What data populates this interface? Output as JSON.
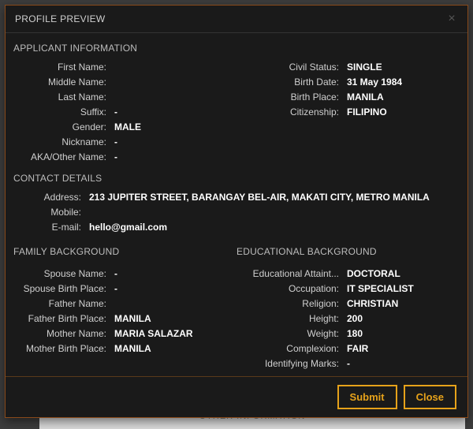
{
  "backdrop_title": "OTHER INFORMATION",
  "modal": {
    "title": "PROFILE PREVIEW",
    "close_x": "×"
  },
  "sections": {
    "applicant": "APPLICANT INFORMATION",
    "contact": "CONTACT DETAILS",
    "family": "FAMILY BACKGROUND",
    "education": "EDUCATIONAL BACKGROUND"
  },
  "applicant_left": [
    {
      "label": "First Name:",
      "value": ""
    },
    {
      "label": "Middle Name:",
      "value": ""
    },
    {
      "label": "Last Name:",
      "value": ""
    },
    {
      "label": "Suffix:",
      "value": "-"
    },
    {
      "label": "Gender:",
      "value": "MALE"
    },
    {
      "label": "Nickname:",
      "value": "-"
    },
    {
      "label": "AKA/Other Name:",
      "value": "-"
    }
  ],
  "applicant_right": [
    {
      "label": "Civil Status:",
      "value": "SINGLE"
    },
    {
      "label": "Birth Date:",
      "value": "31 May 1984"
    },
    {
      "label": "Birth Place:",
      "value": "MANILA"
    },
    {
      "label": "Citizenship:",
      "value": "FILIPINO"
    }
  ],
  "contact": [
    {
      "label": "Address:",
      "value": "213 JUPITER STREET, BARANGAY BEL-AIR, MAKATI CITY, METRO MANILA"
    },
    {
      "label": "Mobile:",
      "value": ""
    },
    {
      "label": "E-mail:",
      "value": "hello@gmail.com"
    }
  ],
  "family": [
    {
      "label": "Spouse Name:",
      "value": "-"
    },
    {
      "label": "Spouse Birth Place:",
      "value": "-"
    },
    {
      "label": "Father Name:",
      "value": ""
    },
    {
      "label": "Father Birth Place:",
      "value": "MANILA"
    },
    {
      "label": "Mother Name:",
      "value": "MARIA SALAZAR"
    },
    {
      "label": "Mother Birth Place:",
      "value": "MANILA"
    }
  ],
  "education": [
    {
      "label": "Educational Attaint...",
      "value": "DOCTORAL"
    },
    {
      "label": "Occupation:",
      "value": "IT SPECIALIST"
    },
    {
      "label": "Religion:",
      "value": "CHRISTIAN"
    },
    {
      "label": "Height:",
      "value": "200"
    },
    {
      "label": "Weight:",
      "value": "180"
    },
    {
      "label": "Complexion:",
      "value": "FAIR"
    },
    {
      "label": "Identifying Marks:",
      "value": "-"
    }
  ],
  "buttons": {
    "submit": "Submit",
    "close": "Close"
  }
}
